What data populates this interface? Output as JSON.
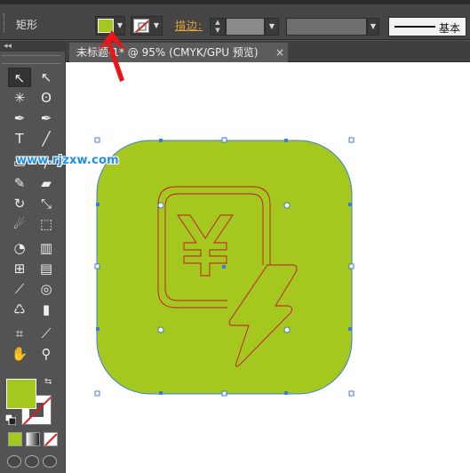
{
  "control_bar": {
    "tool_name": "矩形",
    "stroke_label": "描边",
    "stroke_label_colon": ":",
    "brush_definition": "基本"
  },
  "document_tab": {
    "title": "未标题-1* @ 95% (CMYK/GPU 预览)",
    "close_glyph": "×"
  },
  "collapse_glyph": "◂◂",
  "watermark": "www.rjzxw.com",
  "colors": {
    "fill": "#a4c81e",
    "icon_stroke": "#c8102e",
    "selection": "#3d7bde",
    "ui_bg": "#535353",
    "accent_label": "#e8a23a"
  },
  "artwork": {
    "shape": "rounded-rectangle",
    "icon": "yuan-document-lightning-icon",
    "currency_glyph": "¥"
  },
  "tools": [
    {
      "name": "selection-tool",
      "glyph": "↖"
    },
    {
      "name": "direct-selection-tool",
      "glyph": "↖"
    },
    {
      "name": "magic-wand-tool",
      "glyph": "✳"
    },
    {
      "name": "lasso-tool",
      "glyph": "ʘ"
    },
    {
      "name": "pen-tool",
      "glyph": "✒"
    },
    {
      "name": "curvature-tool",
      "glyph": "✒"
    },
    {
      "name": "type-tool",
      "glyph": "T"
    },
    {
      "name": "line-tool",
      "glyph": "╱"
    },
    {
      "name": "rectangle-tool",
      "glyph": "▭"
    },
    {
      "name": "paintbrush-tool",
      "glyph": "∕"
    },
    {
      "name": "pencil-tool",
      "glyph": "✎"
    },
    {
      "name": "eraser-tool",
      "glyph": "▰"
    },
    {
      "name": "rotate-tool",
      "glyph": "↻"
    },
    {
      "name": "scale-tool",
      "glyph": "⤡"
    },
    {
      "name": "warp-tool",
      "glyph": "☄"
    },
    {
      "name": "free-transform-tool",
      "glyph": "⬚"
    },
    {
      "name": "shape-builder-tool",
      "glyph": "◔"
    },
    {
      "name": "perspective-grid-tool",
      "glyph": "▥"
    },
    {
      "name": "mesh-tool",
      "glyph": "⊞"
    },
    {
      "name": "gradient-tool",
      "glyph": "▤"
    },
    {
      "name": "eyedropper-tool",
      "glyph": "⟋"
    },
    {
      "name": "blend-tool",
      "glyph": "◎"
    },
    {
      "name": "symbol-sprayer-tool",
      "glyph": "♺"
    },
    {
      "name": "column-graph-tool",
      "glyph": "▮"
    },
    {
      "name": "artboard-tool",
      "glyph": "⌗"
    },
    {
      "name": "slice-tool",
      "glyph": "⟋"
    },
    {
      "name": "hand-tool",
      "glyph": "✋"
    },
    {
      "name": "zoom-tool",
      "glyph": "⚲"
    }
  ]
}
